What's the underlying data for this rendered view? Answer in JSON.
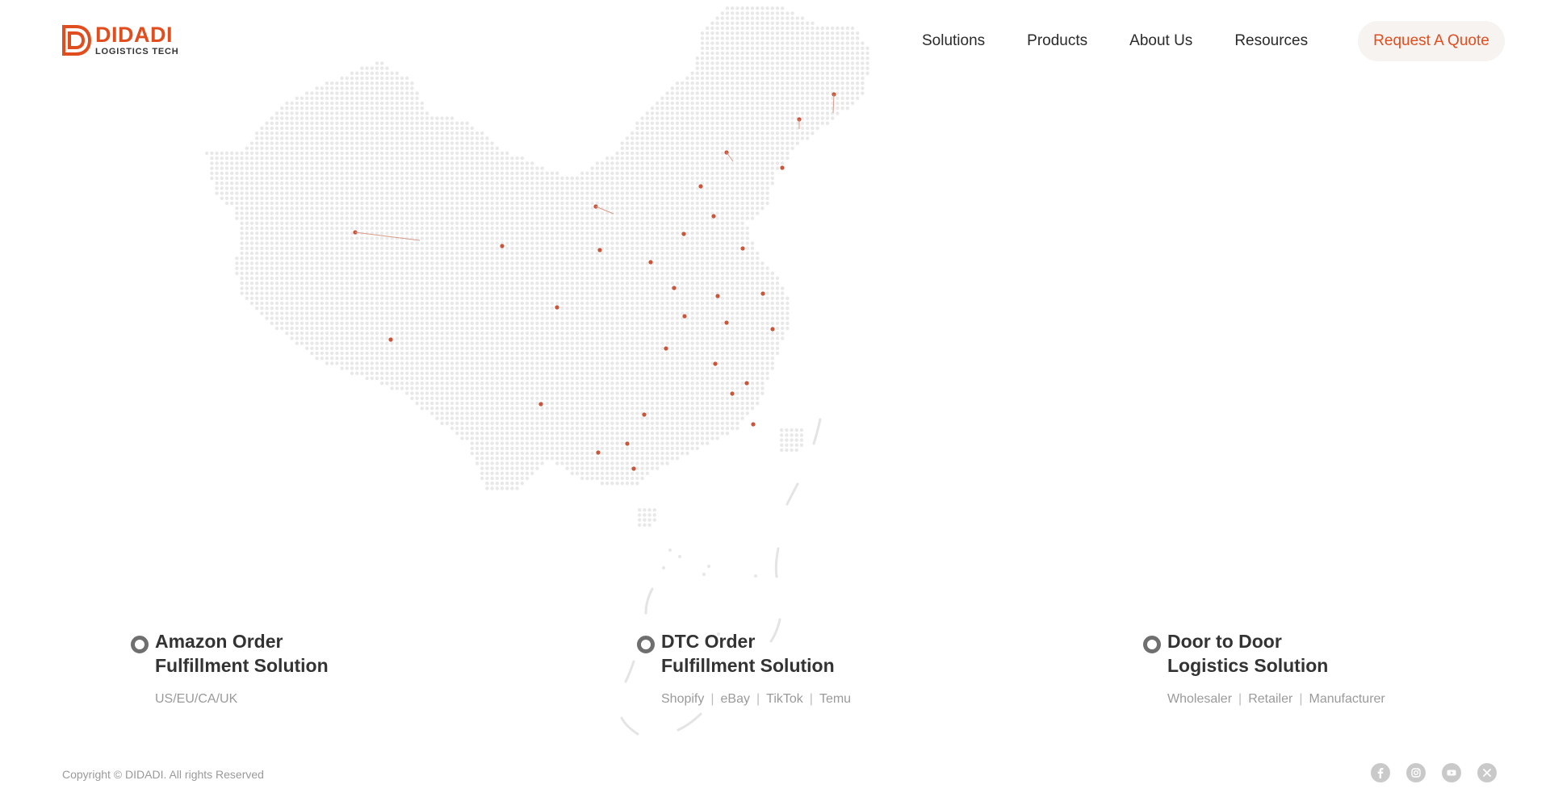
{
  "brand": {
    "name": "DIDADI",
    "tagline": "LOGISTICS TECH",
    "color": "#e04e1f"
  },
  "nav": {
    "items": [
      "Solutions",
      "Products",
      "About Us",
      "Resources"
    ],
    "cta_label": "Request A Quote"
  },
  "map": {
    "dot_color": "#e8e8e8",
    "pin_color": "#c9553a"
  },
  "solutions": [
    {
      "title_line1": "Amazon Order",
      "title_line2": "Fulfillment Solution",
      "tags": [
        "US/EU/CA/UK"
      ]
    },
    {
      "title_line1": "DTC Order",
      "title_line2": "Fulfillment Solution",
      "tags": [
        "Shopify",
        "eBay",
        "TikTok",
        "Temu"
      ]
    },
    {
      "title_line1": "Door to Door",
      "title_line2": "Logistics Solution",
      "tags": [
        "Wholesaler",
        "Retailer",
        "Manufacturer"
      ]
    }
  ],
  "footer": {
    "copyright": "Copyright © DIDADI. All rights Reserved",
    "social_icons": [
      "facebook-icon",
      "instagram-icon",
      "youtube-icon",
      "x-icon"
    ]
  }
}
